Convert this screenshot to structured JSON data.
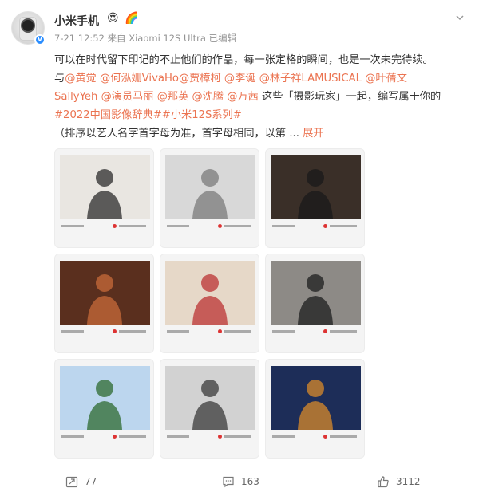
{
  "post": {
    "author": "小米手机",
    "badges": [
      "😍",
      "🌈"
    ],
    "time": "7-21 12:52",
    "source": "来自 Xiaomi 12S Ultra",
    "edited": "已编辑",
    "lines": [
      [
        {
          "t": "可以在时代留下印记的不止他们的作品，每一张定格的瞬间，也是一次未完待续。",
          "c": "text"
        }
      ],
      [
        {
          "t": "与",
          "c": "text"
        },
        {
          "t": "@黄觉",
          "c": "mention"
        },
        {
          "t": " ",
          "c": "text"
        },
        {
          "t": "@何泓姗VivaHo",
          "c": "mention"
        },
        {
          "t": "@贾樟柯",
          "c": "mention"
        },
        {
          "t": " ",
          "c": "text"
        },
        {
          "t": "@李诞",
          "c": "mention"
        },
        {
          "t": " ",
          "c": "text"
        },
        {
          "t": "@林子祥LAMUSICAL",
          "c": "mention"
        },
        {
          "t": " ",
          "c": "text"
        },
        {
          "t": "@叶蒨文",
          "c": "mention"
        }
      ],
      [
        {
          "t": "SallyYeh",
          "c": "mention"
        },
        {
          "t": " ",
          "c": "text"
        },
        {
          "t": "@演员马丽",
          "c": "mention"
        },
        {
          "t": " ",
          "c": "text"
        },
        {
          "t": "@那英",
          "c": "mention"
        },
        {
          "t": " ",
          "c": "text"
        },
        {
          "t": "@沈腾",
          "c": "mention"
        },
        {
          "t": " ",
          "c": "text"
        },
        {
          "t": "@万茜",
          "c": "mention"
        },
        {
          "t": " 这些「摄影玩家」一起，编写属于你的",
          "c": "text"
        }
      ],
      [
        {
          "t": "#2022中国影像辞典#",
          "c": "tag"
        },
        {
          "t": "#小米12S系列#",
          "c": "tag"
        }
      ],
      [
        {
          "t": "（排序以艺人名字首字母为准，首字母相同，以第  ... ",
          "c": "text"
        },
        {
          "t": "展开",
          "c": "expand"
        }
      ]
    ],
    "photos": [
      {
        "name": "photo-1",
        "bg": "#e9e6e1",
        "fg": "#2b2b2b"
      },
      {
        "name": "photo-2",
        "bg": "#d8d8d8",
        "fg": "#7b7b7b"
      },
      {
        "name": "photo-3",
        "bg": "#3a2f28",
        "fg": "#1a1a1a"
      },
      {
        "name": "photo-4",
        "bg": "#5a2f1e",
        "fg": "#c86b3a"
      },
      {
        "name": "photo-5",
        "bg": "#e6d8c8",
        "fg": "#b33"
      },
      {
        "name": "photo-6",
        "bg": "#8d8a86",
        "fg": "#1e1e1e"
      },
      {
        "name": "photo-7",
        "bg": "#bcd6ee",
        "fg": "#2d6a2f"
      },
      {
        "name": "photo-8",
        "bg": "#d2d2d2",
        "fg": "#3a3a3a"
      },
      {
        "name": "photo-9",
        "bg": "#1d2d58",
        "fg": "#d88a2a"
      }
    ],
    "actions": {
      "repost": "77",
      "comment": "163",
      "like": "3112"
    }
  },
  "colors": {
    "accent": "#eb7350",
    "meta": "#939393",
    "verified": "#2a8dff"
  }
}
